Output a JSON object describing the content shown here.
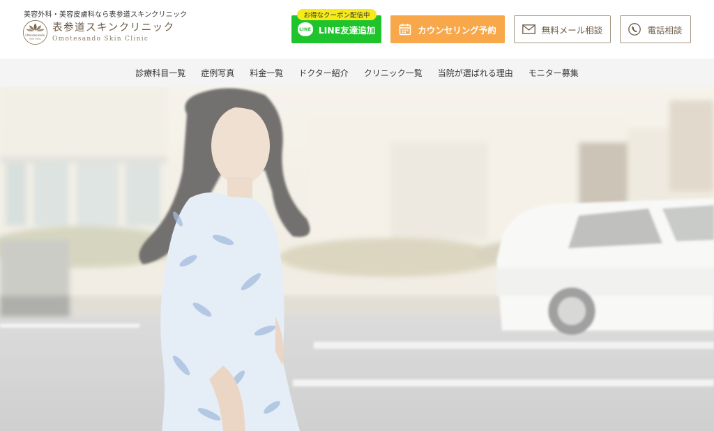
{
  "header": {
    "tagline": "美容外科・美容皮膚科なら表参道スキンクリニック",
    "logo_jp": "表参道スキンクリニック",
    "logo_en": "Omotesando Skin Clinic",
    "logo_mark_text_top": "Omotesando",
    "logo_mark_text_bottom": "Skin Clinic"
  },
  "buttons": {
    "coupon_badge": "お得なクーポン配信中",
    "line_icon": "LINE",
    "line_label": "LINE友達追加",
    "counsel_label": "カウンセリング予約",
    "mail_label": "無料メール相談",
    "tel_label": "電話相談"
  },
  "icons": {
    "line": "line-chat-icon",
    "counsel": "calendar-icon",
    "mail": "envelope-icon",
    "tel": "phone-icon"
  },
  "colors": {
    "line_green": "#1fc42d",
    "coupon_yellow": "#f6ea1a",
    "counsel_orange": "#f8a84a",
    "brand_brown": "#6b5a45",
    "nav_bg": "#f4f4f4"
  },
  "nav": {
    "items": [
      "診療科目一覧",
      "症例写真",
      "料金一覧",
      "ドクター紹介",
      "クリニック一覧",
      "当院が選ばれる理由",
      "モニター募集"
    ]
  }
}
